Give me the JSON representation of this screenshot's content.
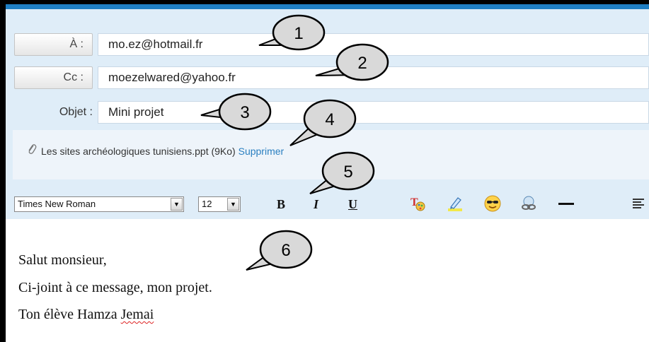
{
  "header": {
    "to_label": "À :",
    "to_value": "mo.ez@hotmail.fr",
    "cc_label": "Cc :",
    "cc_value": "moezelwared@yahoo.fr",
    "subject_label": "Objet :",
    "subject_value": "Mini projet"
  },
  "attachment": {
    "filename": "Les sites archéologiques tunisiens.ppt (9Ko)",
    "remove_label": "Supprimer"
  },
  "toolbar": {
    "font_family": "Times New Roman",
    "font_size": "12",
    "bold_label": "B",
    "italic_label": "I",
    "underline_label": "U",
    "icons": [
      "text-color-icon",
      "highlighter-icon",
      "emoticon-icon",
      "insert-link-icon",
      "horizontal-rule-icon",
      "align-icon"
    ]
  },
  "message": {
    "line1": "Salut monsieur,",
    "line2": "Ci-joint à ce message, mon projet.",
    "line3_prefix": "Ton élève  Hamza ",
    "line3_misspelled": "Jemai"
  },
  "callouts": [
    "1",
    "2",
    "3",
    "4",
    "5",
    "6"
  ]
}
